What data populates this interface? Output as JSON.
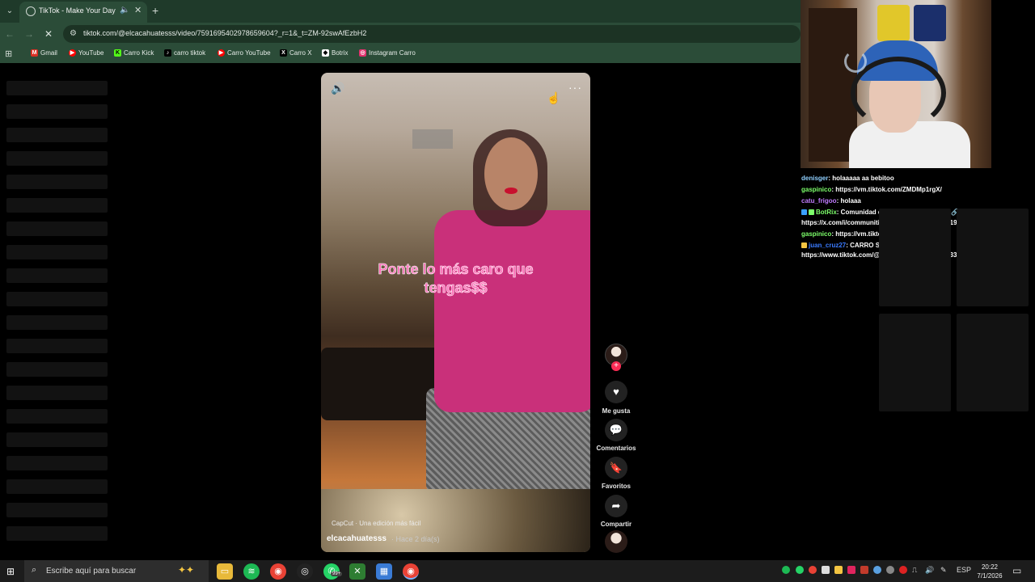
{
  "browser": {
    "tab_title": "TikTok - Make Your Day",
    "url": "tiktok.com/@elcacahuatesss/video/7591695402978659604?_r=1&_t=ZM-92swAfEzbH2",
    "bookmarks": [
      "Gmail",
      "YouTube",
      "Carro Kick",
      "carro tiktok",
      "Carro YouTube",
      "Carro X",
      "Botrix",
      "Instagram Carro"
    ]
  },
  "video": {
    "caption_line1": "Ponte lo más caro que",
    "caption_line2": "tengas$$",
    "capcut_label": "CapCut · Una edición más fácil",
    "author": "elcacahuatesss",
    "posted": "· Hace 2 día(s)"
  },
  "actions": {
    "like": "Me gusta",
    "comments": "Comentarios",
    "favorites": "Favoritos",
    "share": "Compartir"
  },
  "chat": [
    {
      "user": "denisger",
      "user_color": "#8fd0ff",
      "text": ": holaaaaa aa bebitoo"
    },
    {
      "user": "gaspinico",
      "user_color": "#7dff6b",
      "text": ": https://vm.tiktok.com/ZMDMp1rgX/"
    },
    {
      "user": "catu_frigoo",
      "user_color": "#c07cff",
      "text": ": holaaa"
    },
    {
      "user": "BotRix",
      "user_color": "#7dff6b",
      "text": ": Comunidad de Twitter del Carrismo 🔗:"
    },
    {
      "user": "",
      "user_color": "#ffffff",
      "text": "https://x.com/i/communities/1954290053825315319"
    },
    {
      "user": "gaspinico",
      "user_color": "#7dff6b",
      "text": ": https://vm.tiktok.com/ZMDMp1rgX/"
    },
    {
      "user": "juan_cruz27",
      "user_color": "#3a7bff",
      "text": ": CARRO SOS MESSI"
    },
    {
      "user": "",
      "user_color": "#ffffff",
      "text": "https://www.tiktok.com/@clafton_rafael/video/7433904715538222342"
    }
  ],
  "taskbar": {
    "search_placeholder": "Escribe aquí para buscar",
    "whatsapp_badge": "99+",
    "language": "ESP",
    "time": "20:22",
    "date": "7/1/2026"
  }
}
